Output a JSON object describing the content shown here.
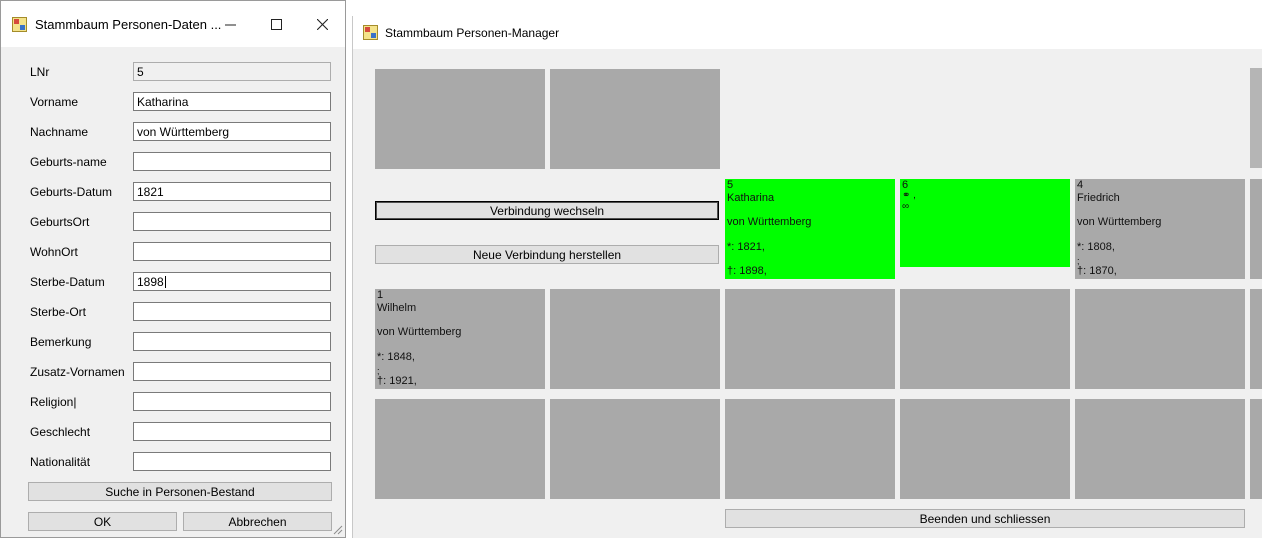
{
  "dialog": {
    "title": "Stammbaum Personen-Daten ...",
    "fields": [
      {
        "label": "LNr",
        "value": "5",
        "readonly": true
      },
      {
        "label": "Vorname",
        "value": "Katharina"
      },
      {
        "label": "Nachname",
        "value": "von Württemberg"
      },
      {
        "label": "Geburts-name",
        "value": ""
      },
      {
        "label": "Geburts-Datum",
        "value": "1821"
      },
      {
        "label": "GeburtsOrt",
        "value": ""
      },
      {
        "label": "WohnOrt",
        "value": ""
      },
      {
        "label": "Sterbe-Datum",
        "value": "1898"
      },
      {
        "label": "Sterbe-Ort",
        "value": ""
      },
      {
        "label": "Bemerkung",
        "value": ""
      },
      {
        "label": "Zusatz-Vornamen",
        "value": ""
      },
      {
        "label": "Religion|",
        "value": ""
      },
      {
        "label": "Geschlecht",
        "value": ""
      },
      {
        "label": "Nationalität",
        "value": ""
      }
    ],
    "search_label": "Suche in Personen-Bestand",
    "ok_label": "OK",
    "cancel_label": "Abbrechen"
  },
  "manager": {
    "title": "Stammbaum Personen-Manager",
    "switch_label": "Verbindung wechseln",
    "new_link_label": "Neue Verbindung herstellen",
    "close_label": "Beenden und schliessen",
    "persons": {
      "katharina": {
        "id": "5",
        "first": "Katharina",
        "last": "von Württemberg",
        "birth": "*: 1821,",
        "death": "†: 1898,"
      },
      "marriage": {
        "id": "6",
        "line1": "⚭ ,",
        "line2": "∞"
      },
      "friedrich": {
        "id": "4",
        "first": "Friedrich",
        "last": "von Württemberg",
        "birth": "*: 1808,",
        "semi": ";",
        "death": "†: 1870,"
      },
      "wilhelm": {
        "id": "1",
        "first": "Wilhelm",
        "last": "von Württemberg",
        "birth": "*: 1848,",
        "semi": ";",
        "death": "†: 1921,"
      }
    }
  },
  "colors": {
    "tile_gray": "#a9a9a9",
    "tile_green": "#00ff00",
    "window_bg": "#f0f0f0"
  }
}
